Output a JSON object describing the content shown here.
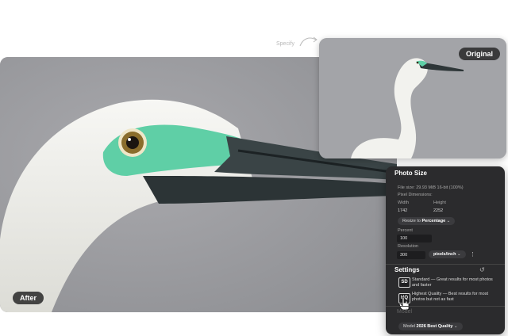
{
  "after_label": "After",
  "original_label": "Original",
  "specify_label": "Specify",
  "photo_size": {
    "title": "Photo Size",
    "file_size": "File size: 29.93 MiB 16-bit (100%)",
    "pixel_dimensions": "Pixel Dimensions:",
    "width_label": "Width",
    "height_label": "Height",
    "width_value": "1742",
    "height_value": "2252",
    "resize_label": "Resize to",
    "resize_value": "Percentage",
    "percent_label": "Percent",
    "percent_value": "100",
    "resolution_label": "Resolution",
    "resolution_value": "300",
    "resolution_unit": "pixels/inch"
  },
  "settings": {
    "title": "Settings",
    "options": [
      {
        "badge": "SD",
        "text": "Standard — Great results for most photos and faster"
      },
      {
        "badge": "HQ",
        "text": "Highest Quality — Best results for most photos but not as fast"
      }
    ],
    "model_section": "Model",
    "model_label": "Model",
    "model_value": "2026 Best Quality"
  },
  "colors": {
    "panel_bg": "#2b2b2d",
    "egret_lore": "#5fcfa6",
    "photo_bg": "#9a9a9e"
  }
}
